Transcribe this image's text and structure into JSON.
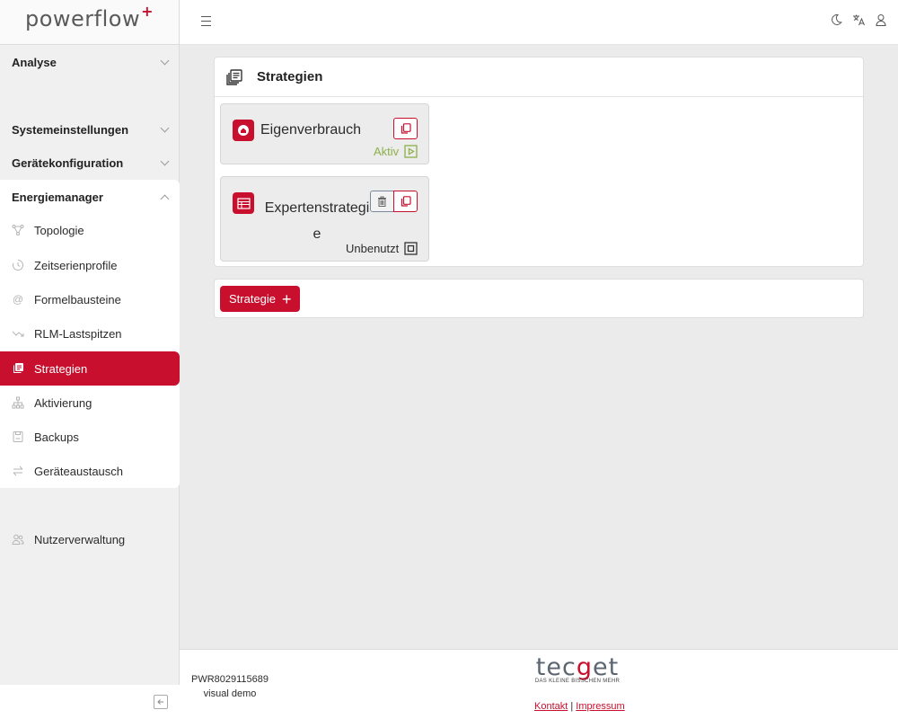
{
  "app": {
    "logo_text": "powerflow",
    "logo_plus": "+"
  },
  "sidebar": {
    "sections": [
      {
        "label": "Analyse",
        "state": "collapsed"
      },
      {
        "label": "Systemeinstellungen",
        "state": "collapsed"
      },
      {
        "label": "Gerätekonfiguration",
        "state": "collapsed"
      },
      {
        "label": "Energiemanager",
        "state": "expanded"
      }
    ],
    "items": [
      {
        "label": "Topologie",
        "icon": "topology-icon"
      },
      {
        "label": "Zeitserienprofile",
        "icon": "timeseries-icon"
      },
      {
        "label": "Formelbausteine",
        "icon": "at-icon"
      },
      {
        "label": "RLM-Lastspitzen",
        "icon": "trend-icon"
      },
      {
        "label": "Strategien",
        "icon": "stack-icon",
        "active": true
      },
      {
        "label": "Aktivierung",
        "icon": "hierarchy-icon"
      },
      {
        "label": "Backups",
        "icon": "backup-icon"
      },
      {
        "label": "Geräteaustausch",
        "icon": "swap-icon"
      }
    ],
    "user_admin": {
      "label": "Nutzerverwaltung",
      "icon": "users-icon"
    }
  },
  "main": {
    "title": "Strategien",
    "strategies": [
      {
        "name": "Eigenverbrauch",
        "status": "Aktiv",
        "icon": "home-icon"
      },
      {
        "name": "Expertenstrategie",
        "status": "Unbenutzt",
        "icon": "table-icon"
      }
    ],
    "add_button": "Strategie"
  },
  "footer": {
    "serial": "PWR8029115689",
    "mode": "visual demo",
    "brand_prefix": "tec",
    "brand_g": "g",
    "brand_suffix": "et",
    "brand_tagline": "DAS KLEINE BISSCHEN MEHR",
    "links": [
      "Kontakt",
      "Impressum"
    ],
    "separator": "|"
  },
  "colors": {
    "accent": "#c8102e",
    "active_status": "#8db04a"
  }
}
